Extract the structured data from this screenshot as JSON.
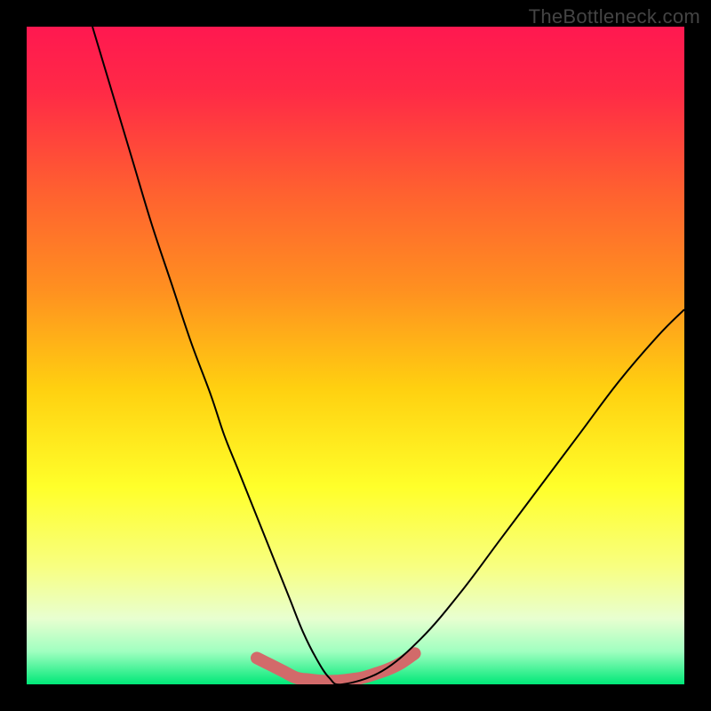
{
  "watermark": "TheBottleneck.com",
  "chart_data": {
    "type": "line",
    "title": "",
    "xlabel": "",
    "ylabel": "",
    "xlim": [
      0,
      100
    ],
    "ylim": [
      0,
      100
    ],
    "background_gradient_stops": [
      {
        "pos": 0.0,
        "color": "#ff1850"
      },
      {
        "pos": 0.1,
        "color": "#ff2a46"
      },
      {
        "pos": 0.25,
        "color": "#ff6030"
      },
      {
        "pos": 0.4,
        "color": "#ff9020"
      },
      {
        "pos": 0.55,
        "color": "#ffd010"
      },
      {
        "pos": 0.7,
        "color": "#ffff2a"
      },
      {
        "pos": 0.82,
        "color": "#f8ff80"
      },
      {
        "pos": 0.9,
        "color": "#e8ffd0"
      },
      {
        "pos": 0.95,
        "color": "#a0ffc0"
      },
      {
        "pos": 1.0,
        "color": "#00e878"
      }
    ],
    "series": [
      {
        "name": "main-curve",
        "stroke": "#000000",
        "stroke_width": 2,
        "x": [
          10,
          13,
          16,
          19,
          22,
          25,
          28,
          30,
          32,
          34,
          36,
          38,
          40,
          42,
          44,
          46,
          48,
          54,
          60,
          66,
          72,
          78,
          84,
          90,
          96,
          100
        ],
        "y": [
          100,
          90,
          80,
          70,
          61,
          52,
          44,
          38,
          33,
          28,
          23,
          18,
          13,
          8,
          4,
          1,
          0,
          2,
          7,
          14,
          22,
          30,
          38,
          46,
          53,
          57
        ]
      },
      {
        "name": "trough-highlight",
        "stroke": "#d26a6a",
        "stroke_width": 14,
        "linecap": "round",
        "x": [
          35,
          37,
          39,
          41,
          43,
          45,
          47,
          49,
          51,
          53,
          55,
          57,
          59
        ],
        "y": [
          4,
          3,
          2,
          1,
          0.7,
          0.5,
          0.5,
          0.7,
          1.0,
          1.6,
          2.3,
          3.3,
          4.7
        ]
      }
    ]
  }
}
